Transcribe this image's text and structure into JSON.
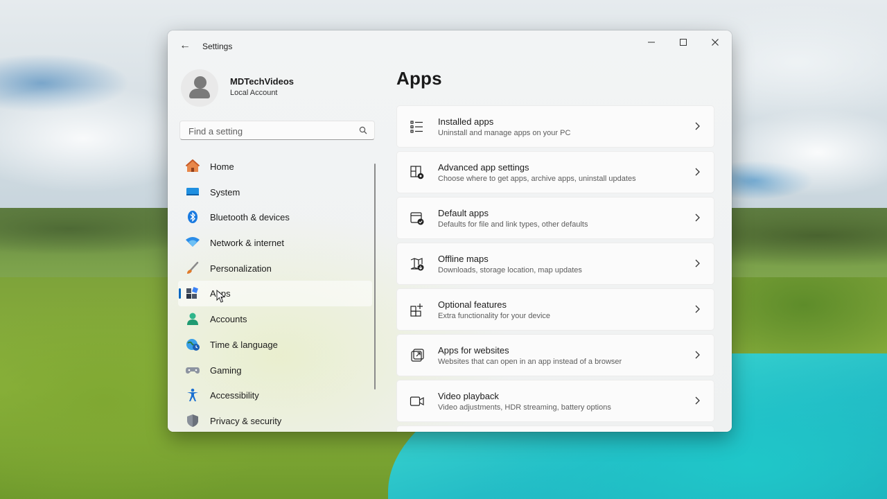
{
  "window": {
    "title": "Settings",
    "back_label": "←",
    "minimize_label": "—",
    "maximize_label": "☐",
    "close_label": "✕"
  },
  "profile": {
    "name": "MDTechVideos",
    "account_type": "Local Account"
  },
  "search": {
    "placeholder": "Find a setting",
    "value": ""
  },
  "sidebar": {
    "items": [
      {
        "label": "Home",
        "icon": "home-icon"
      },
      {
        "label": "System",
        "icon": "system-icon"
      },
      {
        "label": "Bluetooth & devices",
        "icon": "bluetooth-icon"
      },
      {
        "label": "Network & internet",
        "icon": "network-icon"
      },
      {
        "label": "Personalization",
        "icon": "brush-icon"
      },
      {
        "label": "Apps",
        "icon": "apps-icon",
        "selected": true
      },
      {
        "label": "Accounts",
        "icon": "accounts-icon"
      },
      {
        "label": "Time & language",
        "icon": "globe-clock-icon"
      },
      {
        "label": "Gaming",
        "icon": "gamepad-icon"
      },
      {
        "label": "Accessibility",
        "icon": "accessibility-icon"
      },
      {
        "label": "Privacy & security",
        "icon": "shield-icon"
      }
    ]
  },
  "main": {
    "title": "Apps",
    "cards": [
      {
        "title": "Installed apps",
        "description": "Uninstall and manage apps on your PC",
        "icon": "list-icon"
      },
      {
        "title": "Advanced app settings",
        "description": "Choose where to get apps, archive apps, uninstall updates",
        "icon": "app-settings-icon"
      },
      {
        "title": "Default apps",
        "description": "Defaults for file and link types, other defaults",
        "icon": "default-apps-icon"
      },
      {
        "title": "Offline maps",
        "description": "Downloads, storage location, map updates",
        "icon": "map-download-icon"
      },
      {
        "title": "Optional features",
        "description": "Extra functionality for your device",
        "icon": "add-grid-icon"
      },
      {
        "title": "Apps for websites",
        "description": "Websites that can open in an app instead of a browser",
        "icon": "open-external-icon"
      },
      {
        "title": "Video playback",
        "description": "Video adjustments, HDR streaming, battery options",
        "icon": "video-camera-icon"
      }
    ]
  },
  "colors": {
    "accent": "#0067c0"
  }
}
